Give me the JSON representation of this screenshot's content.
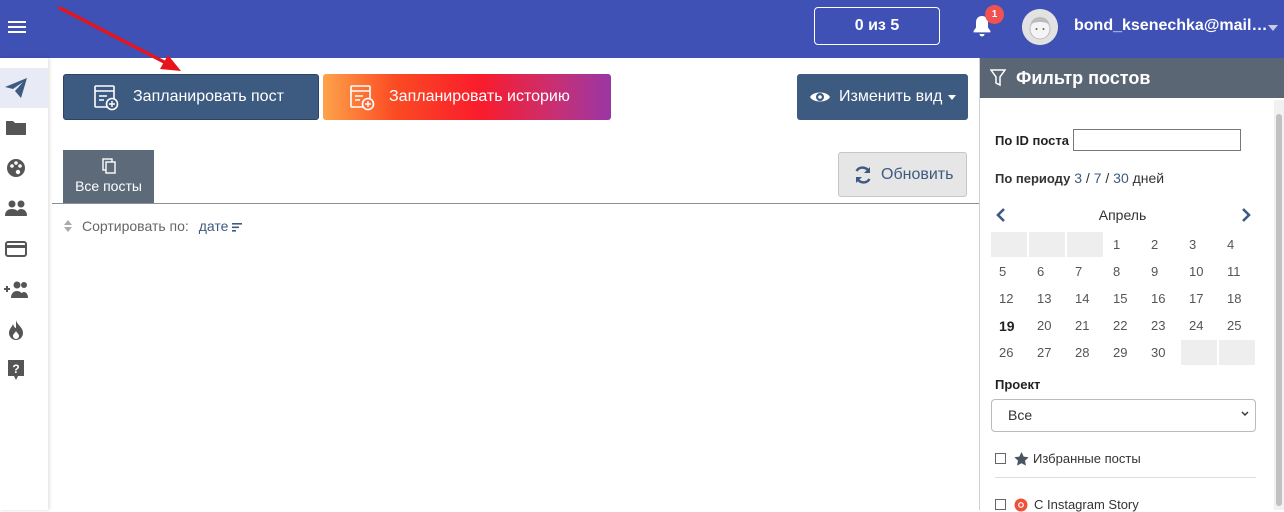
{
  "header": {
    "counter": "0 из 5",
    "notifications_count": "1",
    "username": "bond_ksenechka@mail…"
  },
  "toolbar": {
    "plan_post": "Запланировать пост",
    "plan_story": "Запланировать историю",
    "change_view": "Изменить вид"
  },
  "tabs": {
    "all_posts": "Все посты"
  },
  "refresh": "Обновить",
  "sort": {
    "label": "Сортировать по:",
    "value": "дате"
  },
  "filter": {
    "title": "Фильтр постов",
    "by_id_label": "По ID поста",
    "by_id_value": "",
    "period_label": "По периоду",
    "period_3": "3",
    "period_7": "7",
    "period_30": "30",
    "period_sep": "/",
    "period_unit": "дней",
    "calendar": {
      "month": "Апрель",
      "today": "19",
      "weeks": [
        [
          "",
          "",
          "",
          "1",
          "2",
          "3",
          "4"
        ],
        [
          "5",
          "6",
          "7",
          "8",
          "9",
          "10",
          "11"
        ],
        [
          "12",
          "13",
          "14",
          "15",
          "16",
          "17",
          "18"
        ],
        [
          "19",
          "20",
          "21",
          "22",
          "23",
          "24",
          "25"
        ],
        [
          "26",
          "27",
          "28",
          "29",
          "30",
          "",
          ""
        ]
      ]
    },
    "project_label": "Проект",
    "project_value": "Все",
    "favorite_label": "Избранные посты",
    "instagram_story_label": "С Instagram Story"
  },
  "colors": {
    "topbar": "#3f51b5",
    "primary_button": "#3d5a80",
    "filter_header": "#5a6674",
    "annotation_arrow": "#e8141c"
  },
  "icons": {
    "sidebar": [
      "send-icon",
      "folder-icon",
      "palette-icon",
      "people-icon",
      "card-icon",
      "add-user-icon",
      "fire-icon",
      "help-icon"
    ]
  }
}
